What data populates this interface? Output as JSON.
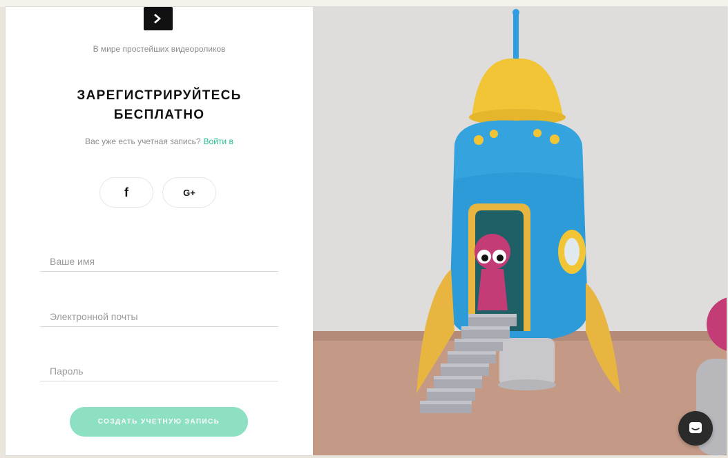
{
  "brand": {
    "logo_icon": "play-chevron-icon",
    "tagline": "В мире простейших видеороликов"
  },
  "signup": {
    "title": "ЗАРЕГИСТРИРУЙТЕСЬ БЕСПЛАТНО",
    "have_account_text": "Вас уже есть учетная запись?",
    "login_link": "Войти в",
    "accent_color": "#27bf93"
  },
  "social": {
    "facebook_label": "f",
    "google_label": "G+"
  },
  "form": {
    "name_placeholder": "Ваше имя",
    "email_placeholder": "Электронной почты",
    "password_placeholder": "Пароль",
    "submit_label": "СОЗДАТЬ УЧЕТНУЮ ЗАПИСЬ",
    "submit_color": "#8ee0c3"
  },
  "illustration": {
    "subject": "clay-rocket-illustration"
  },
  "chat": {
    "icon": "chat-bubble-icon"
  }
}
